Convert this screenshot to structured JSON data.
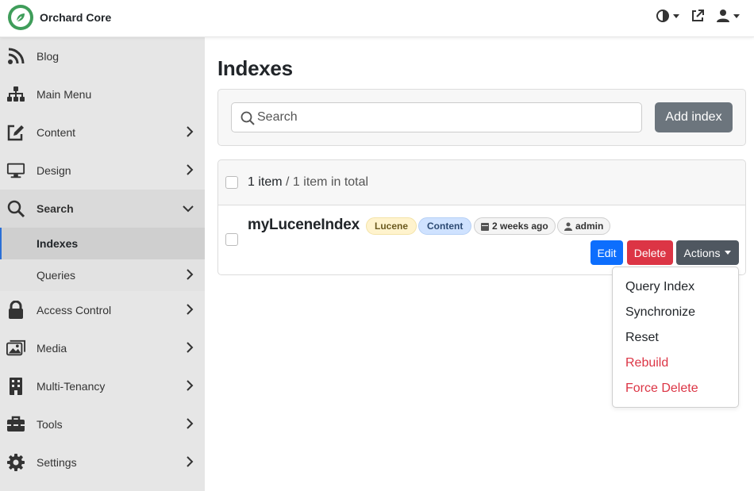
{
  "app": {
    "name": "Orchard Core"
  },
  "sidebar": {
    "items": [
      {
        "label": "Blog",
        "icon": "rss-icon",
        "has_children": false
      },
      {
        "label": "Main Menu",
        "icon": "sitemap-icon",
        "has_children": false
      },
      {
        "label": "Content",
        "icon": "edit-icon",
        "has_children": true
      },
      {
        "label": "Design",
        "icon": "monitor-icon",
        "has_children": true
      },
      {
        "label": "Search",
        "icon": "search-icon",
        "has_children": true,
        "expanded": true
      },
      {
        "label": "Access Control",
        "icon": "lock-icon",
        "has_children": true
      },
      {
        "label": "Media",
        "icon": "images-icon",
        "has_children": true
      },
      {
        "label": "Multi-Tenancy",
        "icon": "building-icon",
        "has_children": true
      },
      {
        "label": "Tools",
        "icon": "toolbox-icon",
        "has_children": true
      },
      {
        "label": "Settings",
        "icon": "gear-icon",
        "has_children": true
      }
    ],
    "search_children": [
      {
        "label": "Indexes",
        "active": true
      },
      {
        "label": "Queries",
        "has_children": true
      }
    ]
  },
  "main": {
    "title": "Indexes",
    "search": {
      "placeholder": "Search",
      "value": ""
    },
    "add_button": "Add index",
    "summary": {
      "count": "1 item",
      "separator": " / ",
      "total": "1 item in total"
    },
    "rows": [
      {
        "name": "myLuceneIndex",
        "badges": {
          "provider": "Lucene",
          "type": "Content",
          "date": "2 weeks ago",
          "user": "admin"
        },
        "buttons": {
          "edit": "Edit",
          "delete": "Delete",
          "actions": "Actions"
        }
      }
    ],
    "actions_menu": [
      "Query Index",
      "Synchronize",
      "Reset",
      "Rebuild",
      "Force Delete"
    ]
  },
  "colors": {
    "brand_green": "#3f9d5a",
    "primary": "#0d6efd",
    "danger": "#dc3545",
    "secondary": "#6c757d",
    "sidebar_bg": "#e6e6e6"
  }
}
